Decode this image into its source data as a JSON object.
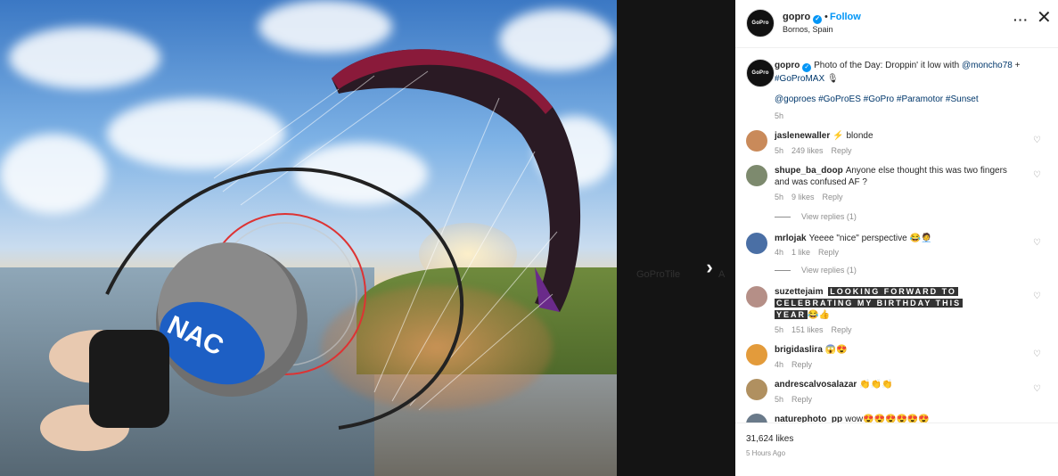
{
  "post": {
    "username": "gopro",
    "follow_label": "Follow",
    "dot": "•",
    "location": "Bornos, Spain",
    "more_icon": "more-icon",
    "close_icon": "close-icon",
    "avatar_text": "GoPro"
  },
  "caption": {
    "username": "gopro",
    "text": "Photo of the Day: Droppin' it low with ",
    "mention": "@moncho78",
    "text2": " + ",
    "hashtag": "#GoProMAX",
    "emoji": "🎙",
    "tags": "@goproes #GoProES #GoPro #Paramotor #Sunset",
    "time": "5h"
  },
  "comments": [
    {
      "username": "jaslenewaller",
      "text": "⚡ blonde",
      "time": "5h",
      "likes": "249 likes",
      "reply": "Reply",
      "avatar_color": "#c98a5a"
    },
    {
      "username": "shupe_ba_doop",
      "text": "Anyone else thought this was two fingers and was confused AF ?",
      "time": "5h",
      "likes": "9 likes",
      "reply": "Reply",
      "view_replies": "View replies (1)",
      "avatar_color": "#7d8a6e"
    },
    {
      "username": "mrlojak",
      "text": "Yeeee \"nice\" perspective 😂🧑‍💼",
      "time": "4h",
      "likes": "1 like",
      "reply": "Reply",
      "view_replies": "View replies (1)",
      "avatar_color": "#4a6fa5"
    },
    {
      "username": "suzettejaim",
      "text_segments": [
        {
          "t": "LOOKING",
          "b": "L"
        },
        {
          "t": "FORWARD",
          "b": "F"
        },
        {
          "t": "TO",
          "b": "T"
        }
      ],
      "line1": "LOOKING FORWARD TO",
      "line2": "CELEBRATING MY BIRTHDAY THIS",
      "line3": "YEAR",
      "line3_emoji": "😂👍",
      "time": "5h",
      "likes": "151 likes",
      "reply": "Reply",
      "avatar_color": "#b58f87"
    },
    {
      "username": "brigidaslira",
      "text": "😱😍",
      "time": "4h",
      "likes": "",
      "reply": "Reply",
      "avatar_color": "#e39b3b"
    },
    {
      "username": "andrescalvosalazar",
      "text": "👏👏👏",
      "time": "5h",
      "likes": "",
      "reply": "Reply",
      "avatar_color": "#b09060"
    },
    {
      "username": "naturephoto_pp",
      "text": "wow😍😍😍😍😍😍",
      "avatar_color": "#6a7a8a"
    }
  ],
  "footer": {
    "likes": "31,624 likes",
    "ago": "5 Hours Ago"
  },
  "background": {
    "next_icon": "chevron-right-icon",
    "ghost_label_1": "GoProTile",
    "ghost_label_2": "A"
  },
  "colors": {
    "accent": "#0095f6",
    "link": "#00376b",
    "muted": "#8e8e8e"
  }
}
